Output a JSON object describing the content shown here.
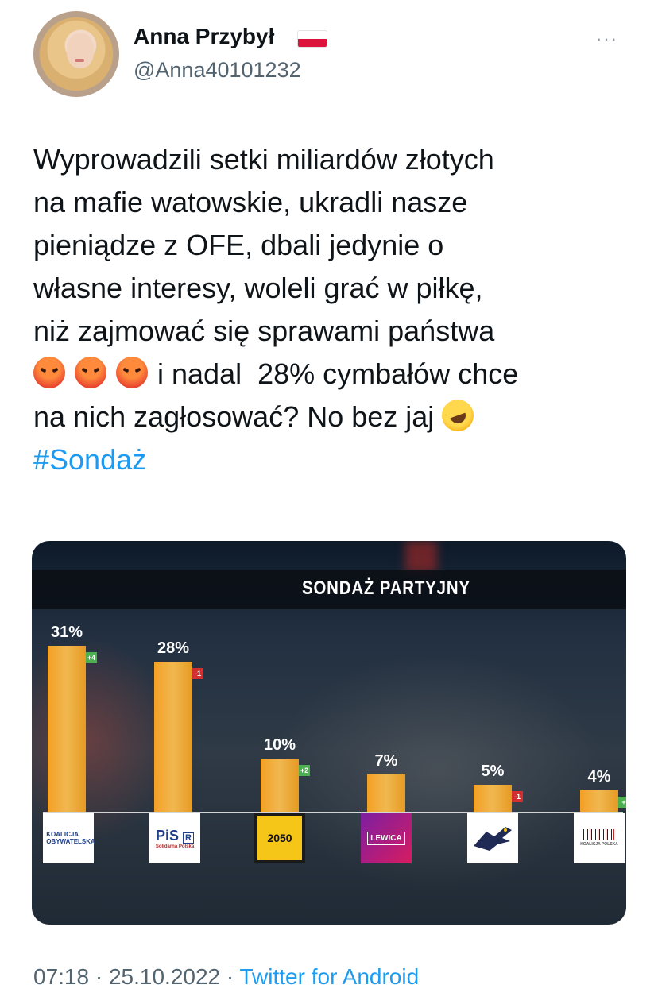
{
  "author": {
    "display_name": "Anna Przybył",
    "handle": "@Anna40101232",
    "flag": "poland-flag",
    "avatar": "user-avatar"
  },
  "more_icon": "···",
  "tweet": {
    "lines": [
      "Wyprowadzili setki miliardów złotych",
      "na mafie watowskie, ukradli nasze",
      "pieniądze z OFE, dbali jedynie o",
      "własne interesy, woleli grać w piłkę,",
      "niż zajmować się sprawami państwa"
    ],
    "line6_text": "i nadal  28% cymbałów chce",
    "line7_text": "na nich zagłosować? No bez jaj",
    "hashtag": "#Sondaż",
    "emojis": [
      "angry-face",
      "angry-face",
      "angry-face",
      "rolling-on-floor-laughing"
    ]
  },
  "media": {
    "title": "SONDAŻ PARTYJNY"
  },
  "chart_data": {
    "type": "bar",
    "title": "SONDAŻ PARTYJNY",
    "categories": [
      "KOALICJA OBYWATELSKA",
      "PiS / Solidarna Polska",
      "2050",
      "LEWICA",
      "Konfederacja",
      "KOALICJA POLSKA"
    ],
    "values": [
      31,
      28,
      10,
      7,
      5,
      4
    ],
    "value_labels": [
      "31%",
      "28%",
      "10%",
      "7%",
      "5%",
      "4%"
    ],
    "changes": [
      "+4",
      "-1",
      "+2",
      "",
      "-1",
      "+"
    ],
    "logo_texts": {
      "ko": [
        "KOALICJA",
        "OBYWATELSKA"
      ],
      "pis": "PiS",
      "pis_r": "R",
      "pis_sub": [
        "Solidarna",
        "Polska"
      ],
      "p2050": "2050",
      "lewica": "LEWICA",
      "psl": "KOALICJA POLSKA"
    },
    "bar_color": "#f4a024"
  },
  "footer": {
    "time": "07:18",
    "separator": "·",
    "date": "25.10.2022",
    "source": "Twitter for Android"
  },
  "colors": {
    "link": "#1d9bf0",
    "muted": "#536471",
    "text": "#0f1419"
  }
}
